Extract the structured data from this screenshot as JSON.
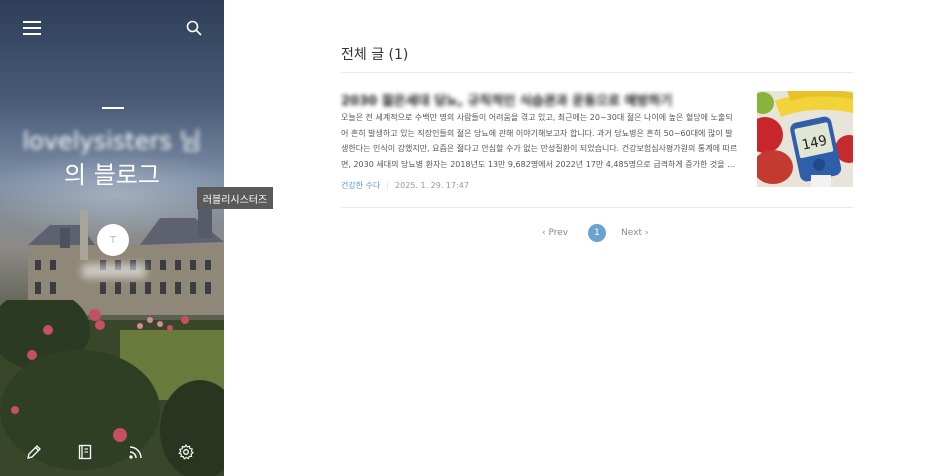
{
  "sidebar": {
    "title_line1": "lovelysisters 님",
    "title_line2": "의 블로그",
    "tooltip": "러블리시스터즈",
    "avatar_letter": "T",
    "icons": {
      "menu": "menu-icon",
      "search": "search-icon",
      "write": "pencil-icon",
      "guestbook": "book-icon",
      "rss": "rss-icon",
      "settings": "gear-icon"
    }
  },
  "main": {
    "section_title": "전체 글 (1)",
    "post": {
      "title": "2030 젊은세대 당뇨, 규칙적인 식습관과 운동으로 예방하기",
      "excerpt": "오늘은 전 세계적으로 수백만 명의 사람들이 어려움을 겪고 있고, 최근에는 20~30대 젊은 나이에 높은 혈당에 노출되어 흔히 발생하고 있는 직장인들의 젊은 당뇨에 관해 이야기해보고자 합니다. 과거 당뇨병은 흔히 50~60대에 많이 발생한다는 인식이 강했지만, 요즘은 젊다고 안심할 수가 없는 만성질환이 되었습니다. 건강보험심사평가원의 통계에 따르면, 2030 세대의 당뇨병 환자는 2018년도 13만 9,682명에서 2022년 17만 4,485명으로 급격하게 증가한 것을 …",
      "category": "건강한 수다",
      "date": "2025. 1. 29. 17:47",
      "meter_reading": "149"
    },
    "pagination": {
      "prev": "Prev",
      "current": "1",
      "next": "Next"
    }
  },
  "colors": {
    "accent": "#6aa3cf",
    "category": "#5a9bd0"
  }
}
